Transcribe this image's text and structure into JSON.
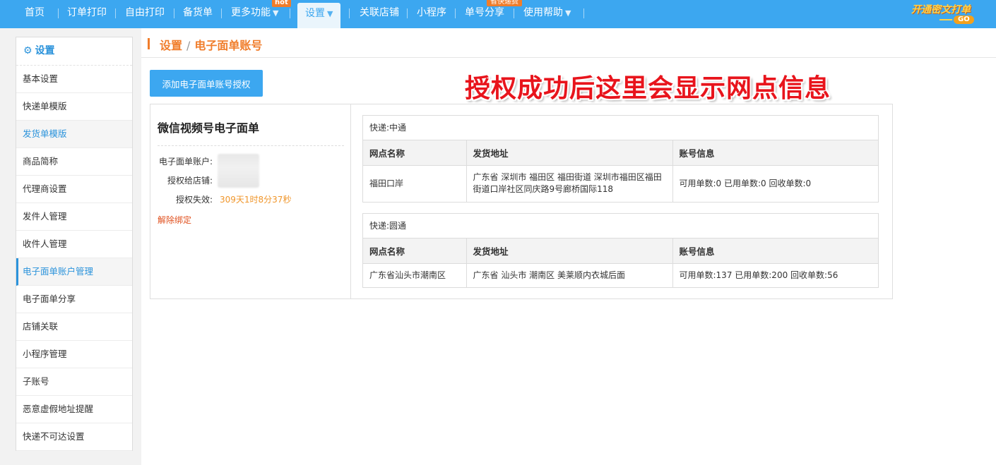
{
  "nav": {
    "items": [
      "首页",
      "订单打印",
      "自由打印",
      "备货单",
      "更多功能",
      "设置",
      "关联店铺",
      "小程序",
      "单号分享",
      "使用帮助"
    ],
    "more_badge": "hot",
    "share_badge": "省快递费",
    "promo_text": "开通密文打单",
    "promo_go": "GO"
  },
  "sidebar": {
    "title": "设置",
    "items": [
      "基本设置",
      "快递单模版",
      "发货单模版",
      "商品简称",
      "代理商设置",
      "发件人管理",
      "收件人管理",
      "电子面单账户管理",
      "电子面单分享",
      "店铺关联",
      "小程序管理",
      "子账号",
      "恶意虚假地址提醒",
      "快递不可达设置"
    ]
  },
  "breadcrumb": {
    "parent": "设置",
    "separator": "/",
    "current": "电子面单账号"
  },
  "add_button": "添加电子面单账号授权",
  "banner": "授权成功后这里会显示网点信息",
  "account": {
    "title": "微信视频号电子面单",
    "account_label": "电子面单账户:",
    "shop_label": "授权给店铺:",
    "expire_label": "授权失效:",
    "expire_value": "309天1时8分37秒",
    "unbind": "解除绑定"
  },
  "columns": [
    "网点名称",
    "发货地址",
    "账号信息"
  ],
  "couriers": [
    {
      "header": "快递:中通",
      "branch": "福田口岸",
      "address": "广东省 深圳市 福田区 福田街道 深圳市福田区福田街道口岸社区同庆路9号廊桥国际118",
      "info": "可用单数:0 已用单数:0 回收单数:0"
    },
    {
      "header": "快递:圆通",
      "branch": "广东省汕头市潮南区",
      "address": "广东省 汕头市 潮南区 美莱顺内衣城后面",
      "info": "可用单数:137 已用单数:200 回收单数:56"
    }
  ]
}
